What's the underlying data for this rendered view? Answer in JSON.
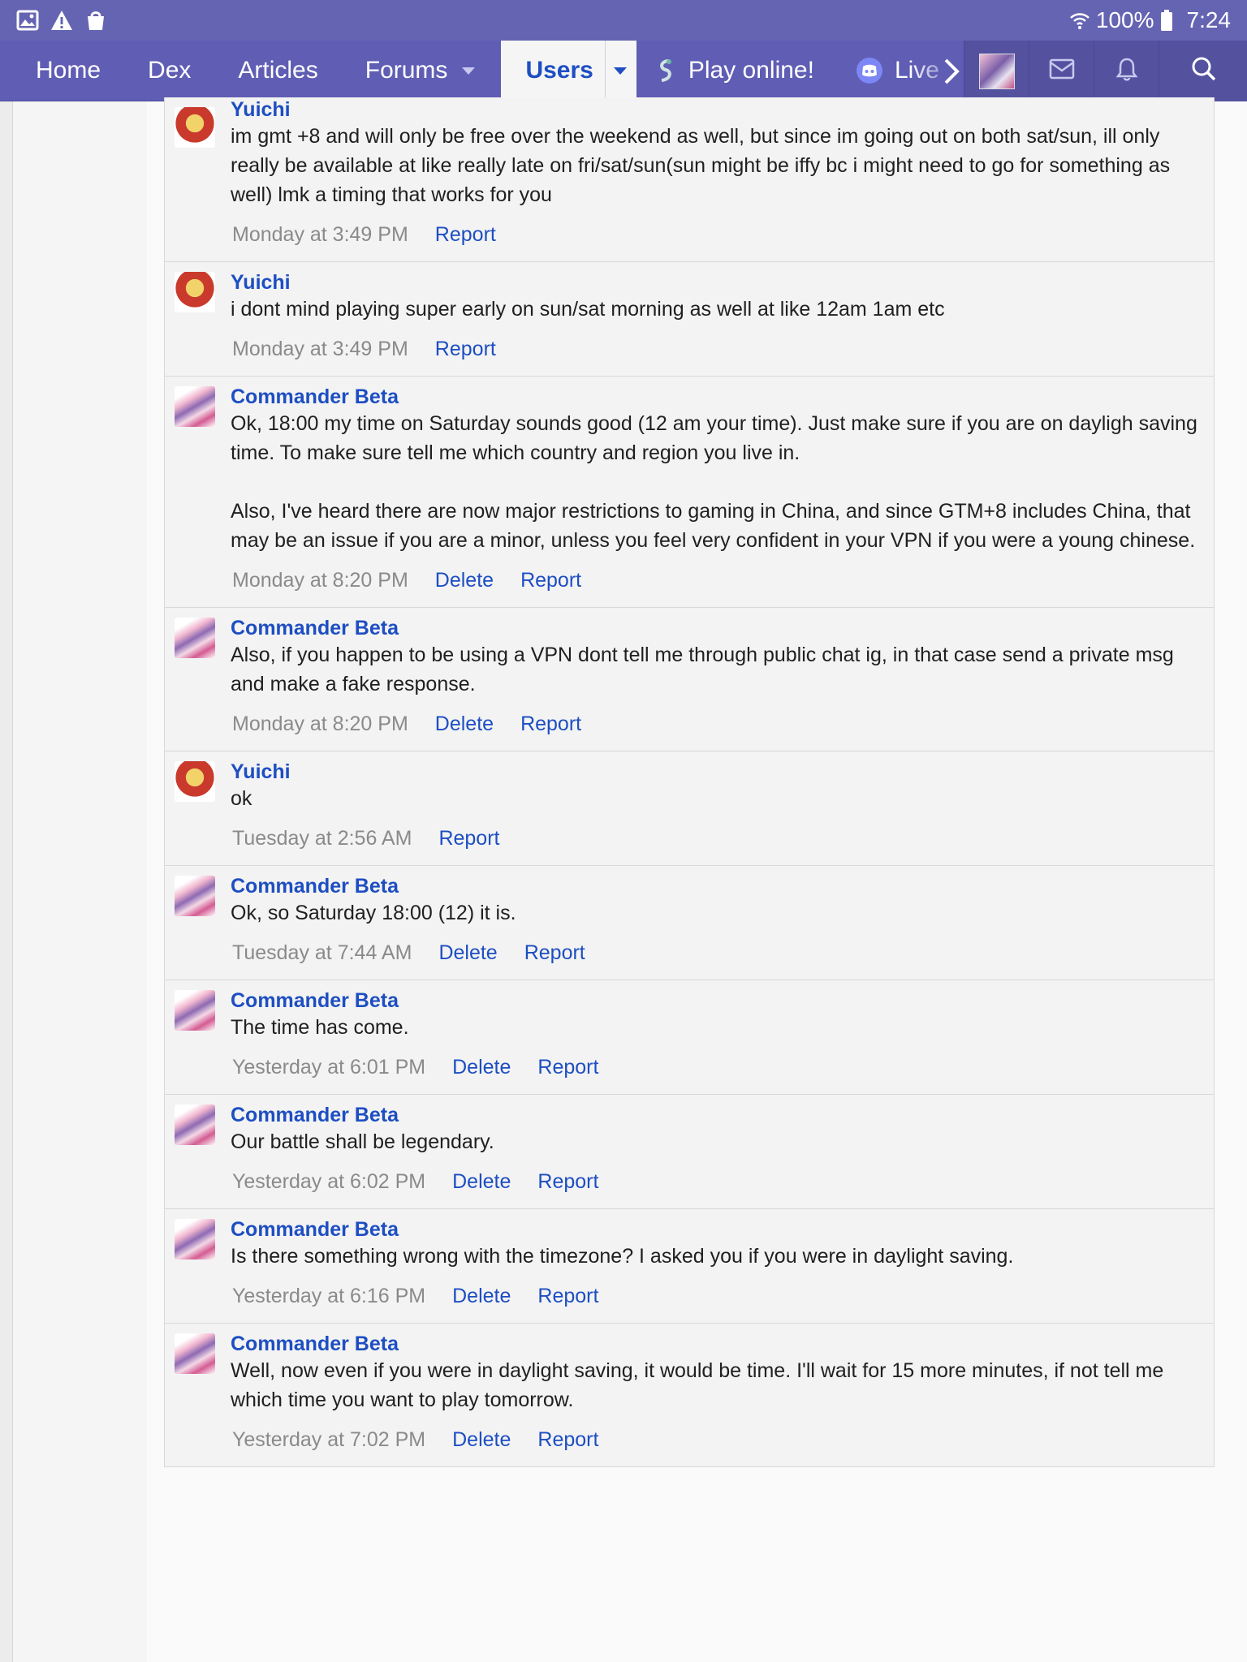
{
  "status_bar": {
    "battery": "100%",
    "clock": "7:24",
    "left_icons": [
      "image-icon",
      "warning-icon",
      "shopping-bag-icon"
    ]
  },
  "nav": {
    "items": [
      {
        "label": "Home"
      },
      {
        "label": "Dex"
      },
      {
        "label": "Articles"
      },
      {
        "label": "Forums"
      },
      {
        "label": "Users"
      },
      {
        "label": "Play online!"
      },
      {
        "label": "Live"
      }
    ],
    "active": "Users"
  },
  "messages": [
    {
      "user": "Yuichi",
      "avatar": "yuichi",
      "text": "im gmt +8 and will only be free over the weekend as well, but since im going out on both sat/sun, ill only really be available at like really late on fri/sat/sun(sun might be iffy bc i might need to go for something as well) lmk a timing that works for you",
      "time": "Monday at 3:49 PM",
      "actions": [
        "Report"
      ]
    },
    {
      "user": "Yuichi",
      "avatar": "yuichi",
      "text": "i dont mind playing super early on sun/sat morning as well at like 12am 1am etc",
      "time": "Monday at 3:49 PM",
      "actions": [
        "Report"
      ]
    },
    {
      "user": "Commander Beta",
      "avatar": "beta",
      "text": "Ok, 18:00 my time on Saturday sounds good (12 am your time). Just make sure if you are on dayligh saving time. To make sure tell me which country and region you live in.\n\nAlso, I've heard there are now major restrictions to gaming in China, and since GTM+8 includes China, that may be an issue if you are a minor, unless you feel very confident in your VPN if you were a young chinese.",
      "time": "Monday at 8:20 PM",
      "actions": [
        "Delete",
        "Report"
      ]
    },
    {
      "user": "Commander Beta",
      "avatar": "beta",
      "text": "Also, if you happen to be using a VPN dont tell me through public chat ig, in that case send a private msg and make a fake response.",
      "time": "Monday at 8:20 PM",
      "actions": [
        "Delete",
        "Report"
      ]
    },
    {
      "user": "Yuichi",
      "avatar": "yuichi",
      "text": "ok",
      "time": "Tuesday at 2:56 AM",
      "actions": [
        "Report"
      ]
    },
    {
      "user": "Commander Beta",
      "avatar": "beta",
      "text": "Ok, so Saturday 18:00 (12) it is.",
      "time": "Tuesday at 7:44 AM",
      "actions": [
        "Delete",
        "Report"
      ]
    },
    {
      "user": "Commander Beta",
      "avatar": "beta",
      "text": "The time has come.",
      "time": "Yesterday at 6:01 PM",
      "actions": [
        "Delete",
        "Report"
      ]
    },
    {
      "user": "Commander Beta",
      "avatar": "beta",
      "text": "Our battle shall be legendary.",
      "time": "Yesterday at 6:02 PM",
      "actions": [
        "Delete",
        "Report"
      ]
    },
    {
      "user": "Commander Beta",
      "avatar": "beta",
      "text": "Is there something wrong with the timezone? I asked you if you were in daylight saving.",
      "time": "Yesterday at 6:16 PM",
      "actions": [
        "Delete",
        "Report"
      ]
    },
    {
      "user": "Commander Beta",
      "avatar": "beta",
      "text": "Well, now even if you were in daylight saving, it would be time. I'll wait for 15 more minutes, if not tell me which time you want to play tomorrow.",
      "time": "Yesterday at 7:02 PM",
      "actions": [
        "Delete",
        "Report"
      ]
    }
  ]
}
